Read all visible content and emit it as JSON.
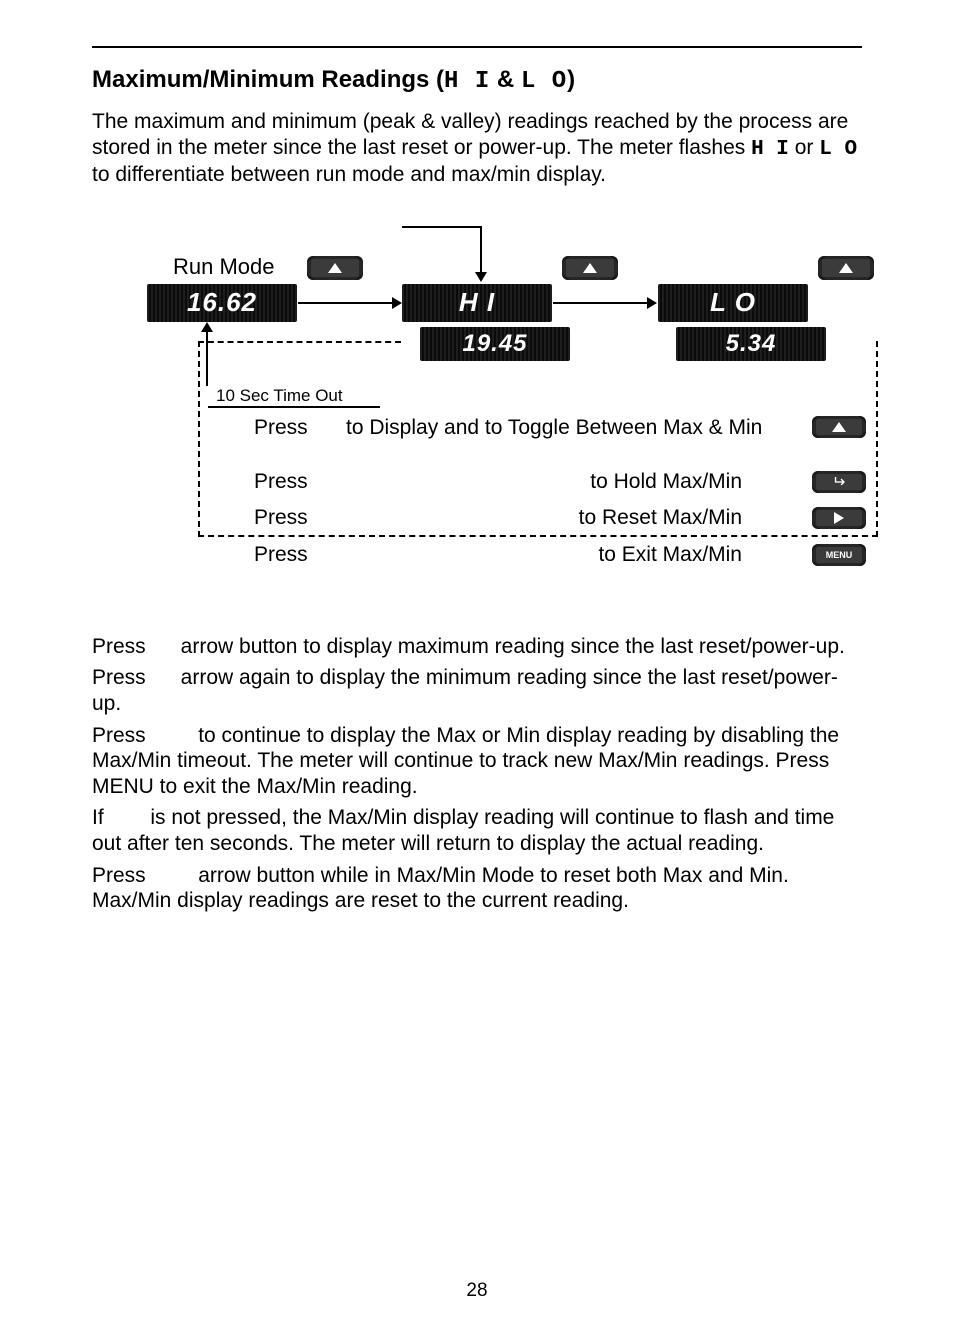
{
  "page": {
    "number": "28"
  },
  "section": {
    "title_prefix": "Maximum/Minimum Readings (",
    "hi": "H I",
    "sep": " & ",
    "lo": "L O",
    "title_suffix": ")"
  },
  "para1_a": "The maximum and minimum (peak & valley) readings reached by the process are stored in the meter since the last reset or power-up. The meter flashes ",
  "para1_hi": "H I",
  "para1_b": " or ",
  "para1_lo": "L O",
  "para1_c": " to differentiate between run mode and max/min display.",
  "diagram": {
    "run_mode_label": "Run Mode",
    "timeout_label": "10 Sec Time Out",
    "lcd_run": "16.62",
    "lcd_hi": "H I",
    "lcd_hi_val": "19.45",
    "lcd_lo": "L O",
    "lcd_lo_val": "5.34",
    "rows": {
      "r1_press": "Press",
      "r1_desc": "to Display and to Toggle Between Max & Min",
      "r2_press": "Press",
      "r2_desc": "to Hold Max/Min",
      "r3_press": "Press",
      "r3_desc": "to Reset Max/Min",
      "r4_press": "Press",
      "r4_desc": "to Exit Max/Min"
    }
  },
  "body": {
    "p1": "Press      arrow button to display maximum reading since the last reset/power-up.",
    "p2": "Press      arrow again to display the minimum reading since the last reset/power-up.",
    "p3": "Press         to continue to display the Max or Min display reading by disabling the Max/Min timeout. The meter will continue to track new Max/Min readings. Press MENU to exit the Max/Min reading.",
    "p4": "If        is not pressed, the Max/Min display reading will continue to flash and time out after ten seconds. The meter will return to display the actual reading.",
    "p5": "Press         arrow button while in Max/Min Mode to reset both Max and Min. Max/Min display readings are reset to the current reading."
  }
}
